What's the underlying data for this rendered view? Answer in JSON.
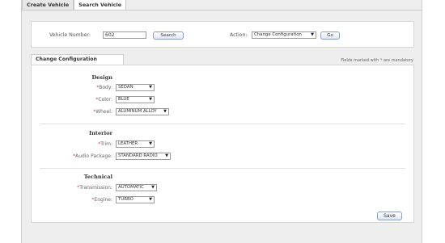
{
  "tabs": [
    {
      "label": "Create Vehicle"
    },
    {
      "label": "Search Vehicle"
    }
  ],
  "search": {
    "vehicle_number_label": "Vehicle Number:",
    "vehicle_number_value": "602",
    "search_button": "Search",
    "action_label": "Action:",
    "action_value": "Change Configuration",
    "go_button": "Go"
  },
  "config": {
    "tab_label": "Change Configuration",
    "mandatory_note_prefix": "Fields marked with",
    "mandatory_star": "*",
    "mandatory_note_suffix": "are mandatory",
    "sections": {
      "design": "Design",
      "interior": "Interior",
      "technical": "Technical"
    },
    "fields": {
      "body": {
        "label": "Body:",
        "value": "SEDAN"
      },
      "color": {
        "label": "Color:",
        "value": "BLUE"
      },
      "wheel": {
        "label": "Wheel:",
        "value": "ALUMINUM ALLOY"
      },
      "trim": {
        "label": "Trim:",
        "value": "LEATHER"
      },
      "audio": {
        "label": "Audio Package:",
        "value": "STANDARD RADIO"
      },
      "transmission": {
        "label": "Transmission:",
        "value": "AUTOMATIC"
      },
      "engine": {
        "label": "Engine:",
        "value": "TURBO"
      }
    },
    "save_button": "Save"
  }
}
